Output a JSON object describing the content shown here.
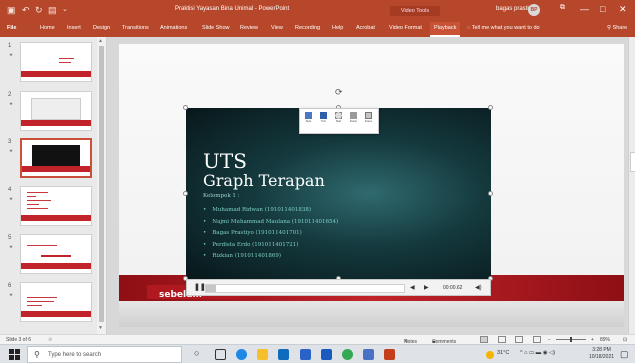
{
  "titlebar": {
    "title": "Praktisi Yayasan Bina Unimal - PowerPoint",
    "context_group": "Video Tools",
    "user_name": "bagas prastiyo",
    "user_initials": "BP",
    "window_controls": [
      "⧉",
      "—",
      "□",
      "✕"
    ]
  },
  "tabs": {
    "file": "File",
    "items": [
      "Home",
      "Insert",
      "Design",
      "Transitions",
      "Animations",
      "Slide Show",
      "Review",
      "View",
      "Recording",
      "Help",
      "Acrobat",
      "Video Format",
      "Playback"
    ],
    "active": "Playback",
    "tell_me": "Tell me what you want to do",
    "share": "Share"
  },
  "thumbnails": [
    {
      "number": "1",
      "star": "★"
    },
    {
      "number": "2",
      "star": "★"
    },
    {
      "number": "3",
      "star": "★"
    },
    {
      "number": "4",
      "star": "★"
    },
    {
      "number": "5",
      "star": "★"
    },
    {
      "number": "6",
      "star": "★"
    }
  ],
  "slide": {
    "title": "UTS",
    "subtitle": "Graph Terapan",
    "group": "Kelompok 1 :",
    "members": [
      "Muhamad Ridwan (191011401838)",
      "Najmi Muhammad Maulana (191011401654)",
      "Bagas Prastiyo (191011401701)",
      "Perdista Erdo (191011401721)",
      "Rizkian (191011401869)"
    ],
    "brand": "sebelum"
  },
  "player": {
    "pause_icon": "pause-icon",
    "time": "00:00.62",
    "progress": 0.05
  },
  "mini_toolbar": {
    "buttons": [
      "Style",
      "Trim",
      "Start",
      "Poster",
      "Frame"
    ]
  },
  "statusbar": {
    "slide_info": "Slide 3 of 6",
    "notes": "Notes",
    "comments": "Comments",
    "zoom": "89%"
  },
  "taskbar": {
    "search_placeholder": "Type here to search",
    "weather": "31°C",
    "time": "3:28 PM",
    "date": "10/18/2021"
  },
  "colors": {
    "accent": "#b7472a",
    "slide_red": "#c0242a",
    "video_bg": "#14393d"
  }
}
